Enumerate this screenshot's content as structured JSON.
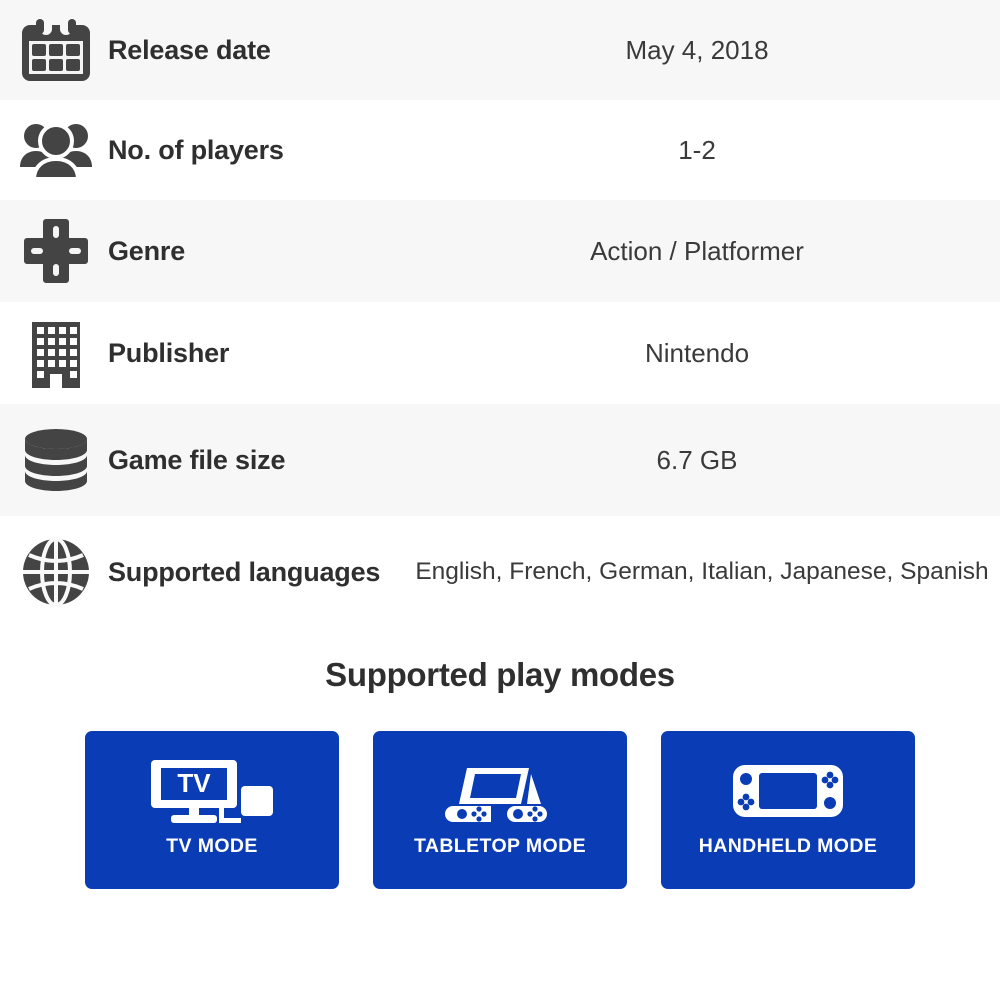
{
  "spec_rows": [
    {
      "icon": "calendar-icon",
      "label": "Release date",
      "value": "May 4, 2018",
      "shaded": true
    },
    {
      "icon": "players-group-icon",
      "label": "No. of players",
      "value": "1-2",
      "shaded": false
    },
    {
      "icon": "dpad-icon",
      "label": "Genre",
      "value": "Action / Platformer",
      "shaded": true
    },
    {
      "icon": "building-icon",
      "label": "Publisher",
      "value": "Nintendo",
      "shaded": false
    },
    {
      "icon": "database-icon",
      "label": "Game file size",
      "value": "6.7 GB",
      "shaded": true
    },
    {
      "icon": "globe-icon",
      "label": "Supported languages",
      "value": "English, French, German, Italian, Japanese, Spanish",
      "shaded": false
    }
  ],
  "play_modes": {
    "title": "Supported play modes",
    "tiles": [
      {
        "icon": "tv-dock-icon",
        "label": "TV MODE",
        "screen_text": "TV"
      },
      {
        "icon": "tabletop-console-icon",
        "label": "TABLETOP MODE"
      },
      {
        "icon": "handheld-console-icon",
        "label": "HANDHELD MODE"
      }
    ]
  },
  "colors": {
    "tile_blue": "#0A3CB5",
    "row_shaded": "#F7F7F7",
    "row_plain": "#FFFFFF",
    "label_text": "#2F2F2F",
    "value_text": "#3A3A3A",
    "icon_gray": "#444444",
    "tile_text": "#FFFFFF"
  }
}
